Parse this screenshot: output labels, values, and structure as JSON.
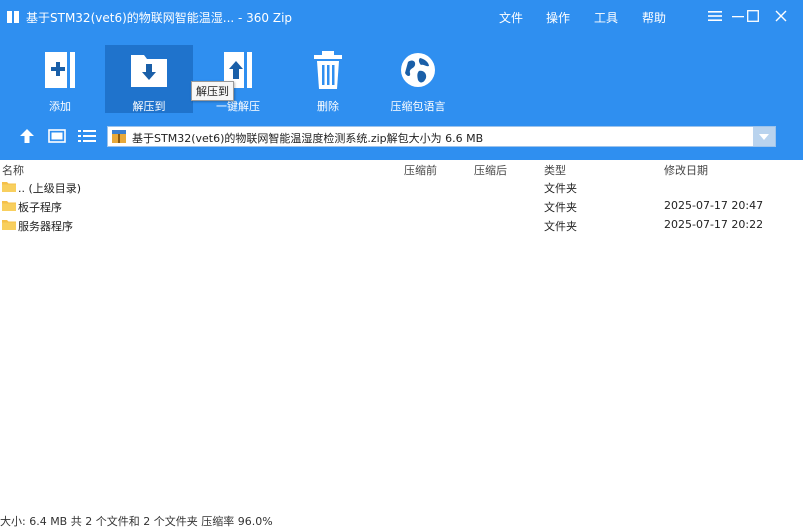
{
  "window": {
    "title": "基于STM32(vet6)的物联网智能温湿... - 360 Zip",
    "menu": [
      "文件",
      "操作",
      "工具",
      "帮助"
    ]
  },
  "toolbar": {
    "add": "添加",
    "extract_to": "解压到",
    "one_click_extract": "一键解压",
    "delete": "删除",
    "languages": "压缩包语言"
  },
  "tooltip": "解压到",
  "address": {
    "path": "基于STM32(vet6)的物联网智能温湿度检测系统.zip解包大小为 6.6 MB"
  },
  "columns": {
    "name": "名称",
    "before": "压缩前",
    "after": "压缩后",
    "type": "类型",
    "modified": "修改日期"
  },
  "rows": [
    {
      "name": ".. (上级目录)",
      "type": "文件夹",
      "modified": ""
    },
    {
      "name": "板子程序",
      "type": "文件夹",
      "modified": "2025-07-17 20:47"
    },
    {
      "name": "服务器程序",
      "type": "文件夹",
      "modified": "2025-07-17 20:22"
    }
  ],
  "status": "大小: 6.4 MB 共 2 个文件和 2 个文件夹 压缩率 96.0%",
  "colors": {
    "accent": "#2f8ff0",
    "accent_dark": "#1f73cc",
    "folder": "#f5c04a"
  }
}
